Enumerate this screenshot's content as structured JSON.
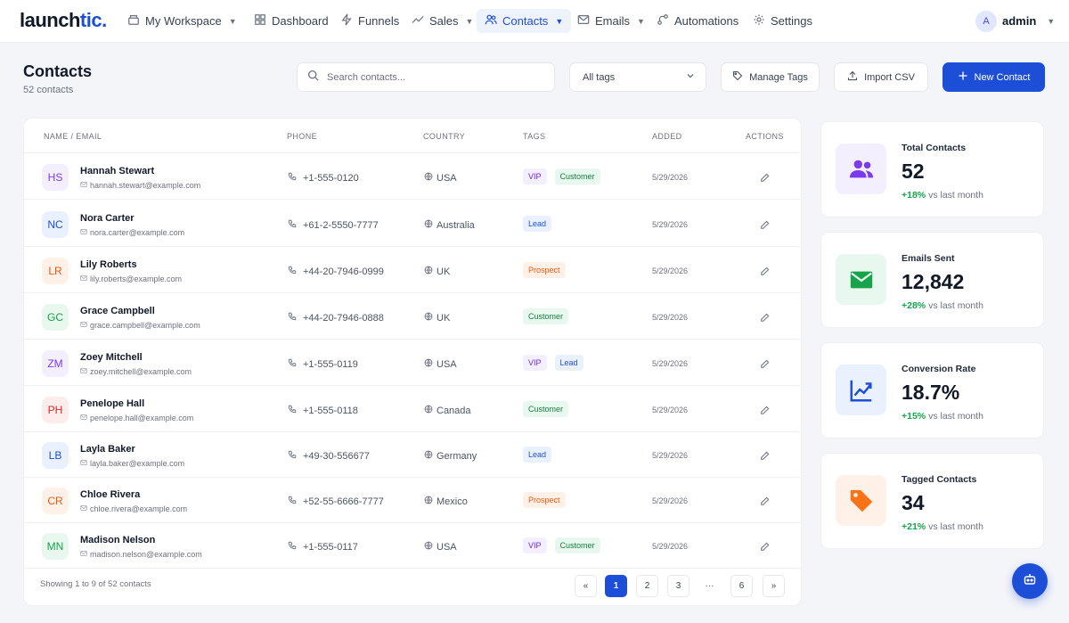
{
  "brand": {
    "name_start": "launch",
    "name_end": "tic.",
    "accent": "#1d4ed8"
  },
  "nav": {
    "workspace": "My Workspace",
    "dashboard": "Dashboard",
    "funnels": "Funnels",
    "sales": "Sales",
    "contacts": "Contacts",
    "emails": "Emails",
    "automations": "Automations",
    "settings": "Settings",
    "user_initial": "A",
    "user_name": "admin"
  },
  "header": {
    "title": "Contacts",
    "subtitle": "52 contacts",
    "search_placeholder": "Search contacts...",
    "tag_filter": "All tags",
    "manage_tags": "Manage Tags",
    "import_csv": "Import CSV",
    "new_contact": "New Contact"
  },
  "table": {
    "headers": {
      "name": "NAME / EMAIL",
      "phone": "PHONE",
      "country": "COUNTRY",
      "tags": "TAGS",
      "added": "ADDED",
      "actions": "ACTIONS"
    },
    "rows": [
      {
        "initials": "HS",
        "color": "purple",
        "name": "Hannah Stewart",
        "email": "hannah.stewart@example.com",
        "phone": "+1-555-0120",
        "country": "USA",
        "tags": [
          "VIP",
          "Customer"
        ],
        "added": "5/29/2026"
      },
      {
        "initials": "NC",
        "color": "blue",
        "name": "Nora Carter",
        "email": "nora.carter@example.com",
        "phone": "+61-2-5550-7777",
        "country": "Australia",
        "tags": [
          "Lead"
        ],
        "added": "5/29/2026"
      },
      {
        "initials": "LR",
        "color": "orange",
        "name": "Lily Roberts",
        "email": "lily.roberts@example.com",
        "phone": "+44-20-7946-0999",
        "country": "UK",
        "tags": [
          "Prospect"
        ],
        "added": "5/29/2026"
      },
      {
        "initials": "GC",
        "color": "green",
        "name": "Grace Campbell",
        "email": "grace.campbell@example.com",
        "phone": "+44-20-7946-0888",
        "country": "UK",
        "tags": [
          "Customer"
        ],
        "added": "5/29/2026"
      },
      {
        "initials": "ZM",
        "color": "purple",
        "name": "Zoey Mitchell",
        "email": "zoey.mitchell@example.com",
        "phone": "+1-555-0119",
        "country": "USA",
        "tags": [
          "VIP",
          "Lead"
        ],
        "added": "5/29/2026"
      },
      {
        "initials": "PH",
        "color": "red",
        "name": "Penelope Hall",
        "email": "penelope.hall@example.com",
        "phone": "+1-555-0118",
        "country": "Canada",
        "tags": [
          "Customer"
        ],
        "added": "5/29/2026"
      },
      {
        "initials": "LB",
        "color": "blue",
        "name": "Layla Baker",
        "email": "layla.baker@example.com",
        "phone": "+49-30-556677",
        "country": "Germany",
        "tags": [
          "Lead"
        ],
        "added": "5/29/2026"
      },
      {
        "initials": "CR",
        "color": "orange",
        "name": "Chloe Rivera",
        "email": "chloe.rivera@example.com",
        "phone": "+52-55-6666-7777",
        "country": "Mexico",
        "tags": [
          "Prospect"
        ],
        "added": "5/29/2026"
      },
      {
        "initials": "MN",
        "color": "green",
        "name": "Madison Nelson",
        "email": "madison.nelson@example.com",
        "phone": "+1-555-0117",
        "country": "USA",
        "tags": [
          "VIP",
          "Customer"
        ],
        "added": "5/29/2026"
      }
    ],
    "footer": "Showing 1 to 9 of 52 contacts",
    "pagination": [
      "«",
      "1",
      "2",
      "3",
      "···",
      "6",
      "»"
    ],
    "current_page": "1"
  },
  "stats": [
    {
      "label": "Total Contacts",
      "value": "52",
      "change": "+18%",
      "suffix": "vs last month",
      "icon": "users-icon",
      "color": "#7c3aed"
    },
    {
      "label": "Emails Sent",
      "value": "12,842",
      "change": "+28%",
      "suffix": "vs last month",
      "icon": "mail-icon",
      "color": "#16a34a"
    },
    {
      "label": "Conversion Rate",
      "value": "18.7%",
      "change": "+15%",
      "suffix": "vs last month",
      "icon": "chart-up-icon",
      "color": "#1d4ed8"
    },
    {
      "label": "Tagged Contacts",
      "value": "34",
      "change": "+21%",
      "suffix": "vs last month",
      "icon": "tag-icon",
      "color": "#f97316"
    }
  ]
}
